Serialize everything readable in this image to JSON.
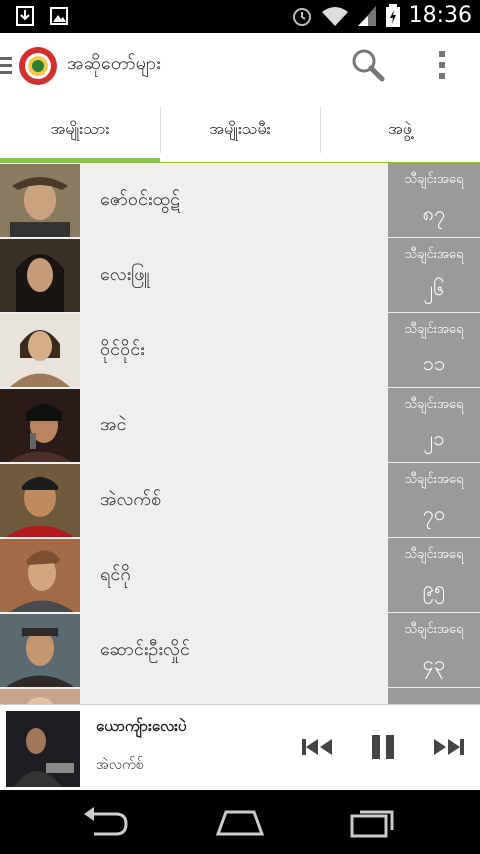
{
  "status_bar": {
    "time": "18:36",
    "icons": [
      "download-icon",
      "image-icon",
      "alarm-icon",
      "wifi-icon",
      "signal-icon",
      "battery-charging-icon"
    ]
  },
  "app_bar": {
    "title": "အဆိုတော်များ",
    "logo": "myanmar-mp3-logo",
    "actions": [
      "search-icon",
      "overflow-menu-icon"
    ]
  },
  "tabs": [
    {
      "label": "အမျိုးသား",
      "selected": true
    },
    {
      "label": "အမျိုးသမီး",
      "selected": false
    },
    {
      "label": "အဖွဲ့",
      "selected": false
    }
  ],
  "artists": [
    {
      "name": "ဇော်ဝင်းထွဋ်",
      "count_label": "သီချင်းအရေ",
      "count": "၈၇",
      "avatar_color": "#8a7a62"
    },
    {
      "name": "လေးဖြူ",
      "count_label": "သီချင်းအရေ",
      "count": "၂၆",
      "avatar_color": "#3b3026"
    },
    {
      "name": "ဝိုင်ဝိုင်း",
      "count_label": "သီချင်းအရေ",
      "count": "၁၁",
      "avatar_color": "#9c7a5a"
    },
    {
      "name": "အငဲ",
      "count_label": "သီချင်းအရေ",
      "count": "၂၁",
      "avatar_color": "#4b2f2a"
    },
    {
      "name": "အဲလက်စ်",
      "count_label": "သီချင်းအရေ",
      "count": "၇၀",
      "avatar_color": "#6f5a3e"
    },
    {
      "name": "ရင်ဂို",
      "count_label": "သီချင်းအရေ",
      "count": "၉၅",
      "avatar_color": "#a26a45"
    },
    {
      "name": "ဆောင်းဦးလှိုင်",
      "count_label": "သီချင်းအရေ",
      "count": "၄၃",
      "avatar_color": "#2e2a28"
    },
    {
      "name": "",
      "count_label": "",
      "count": "",
      "avatar_color": "#c8a58c"
    }
  ],
  "player": {
    "title": "ယောကျ်ားလေးပဲ",
    "artist": "အဲလက်စ်",
    "controls": [
      "previous-icon",
      "pause-icon",
      "next-icon"
    ]
  },
  "nav_bar": [
    "back-icon",
    "home-icon",
    "recents-icon"
  ],
  "colors": {
    "accent": "#8cc63f",
    "count_box": "#9a9a9a",
    "list_bg": "#efefef"
  }
}
